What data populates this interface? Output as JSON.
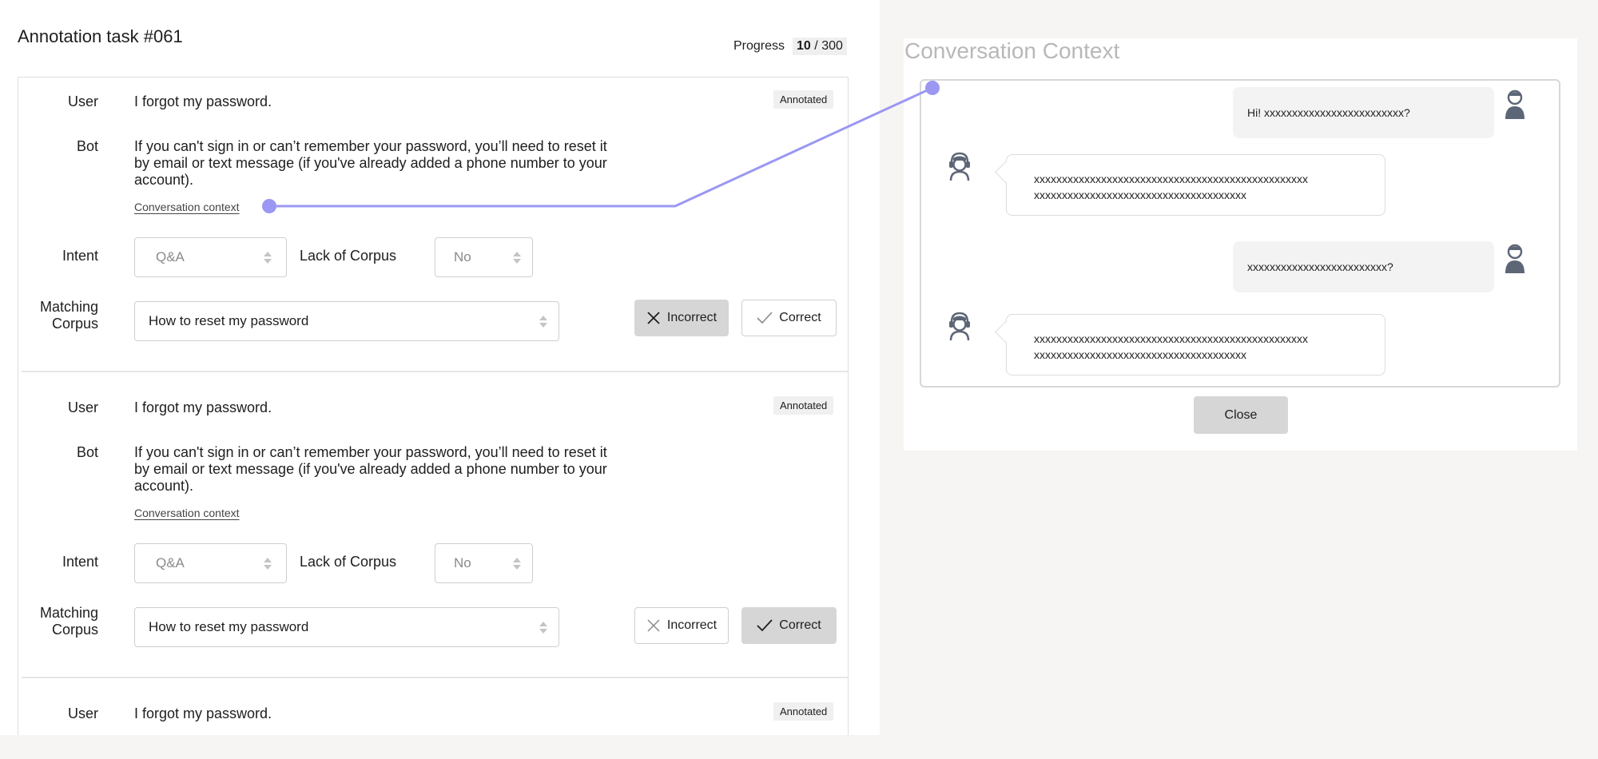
{
  "task": {
    "title": "Annotation task #061",
    "progress_label": "Progress",
    "progress_current": "10",
    "progress_sep": "/",
    "progress_total": "300"
  },
  "field_labels": {
    "user": "User",
    "bot": "Bot",
    "intent": "Intent",
    "lack_of_corpus": "Lack of Corpus",
    "matching_corpus_1": "Matching",
    "matching_corpus_2": "Corpus"
  },
  "items": [
    {
      "status": "Annotated",
      "user_text": "I forgot my password.",
      "bot_text_1": "If you can't sign in or can’t remember your password, you’ll need to reset it",
      "bot_text_2": "by email or text message (if you've already added a phone number to your",
      "bot_text_3": "account).",
      "context_link": "Conversation context",
      "intent": "Q&A",
      "lack_of_corpus": "No",
      "matching_corpus": "How to reset my password",
      "incorrect_label": "Incorrect",
      "correct_label": "Correct",
      "selected": "incorrect"
    },
    {
      "status": "Annotated",
      "user_text": "I forgot my password.",
      "bot_text_1": "If you can't sign in or can’t remember your password, you’ll need to reset it",
      "bot_text_2": "by email or text message (if you've already added a phone number to your",
      "bot_text_3": "account).",
      "context_link": "Conversation context",
      "intent": "Q&A",
      "lack_of_corpus": "No",
      "matching_corpus": "How to reset my password",
      "incorrect_label": "Incorrect",
      "correct_label": "Correct",
      "selected": "correct"
    },
    {
      "status": "Annotated",
      "user_text": "I forgot my password."
    }
  ],
  "context_panel": {
    "title": "Conversation Context",
    "messages": [
      {
        "role": "user",
        "text": "Hi! xxxxxxxxxxxxxxxxxxxxxxxxx?"
      },
      {
        "role": "bot",
        "line1": "xxxxxxxxxxxxxxxxxxxxxxxxxxxxxxxxxxxxxxxxxxxxxxxxx",
        "line2": "xxxxxxxxxxxxxxxxxxxxxxxxxxxxxxxxxxxxxx"
      },
      {
        "role": "user",
        "text": "xxxxxxxxxxxxxxxxxxxxxxxxx?"
      },
      {
        "role": "bot",
        "line1": "xxxxxxxxxxxxxxxxxxxxxxxxxxxxxxxxxxxxxxxxxxxxxxxxx",
        "line2": "xxxxxxxxxxxxxxxxxxxxxxxxxxxxxxxxxxxxxx"
      }
    ],
    "close_label": "Close"
  },
  "colors": {
    "connector": "#9b97f3",
    "active_button": "#d6d6d6",
    "avatar": "#5d6677"
  },
  "icons": {
    "incorrect": "close-x-icon",
    "correct": "check-icon",
    "select": "up-down-arrows-icon",
    "user_avatar": "user-avatar-icon",
    "bot_avatar": "support-agent-icon"
  }
}
